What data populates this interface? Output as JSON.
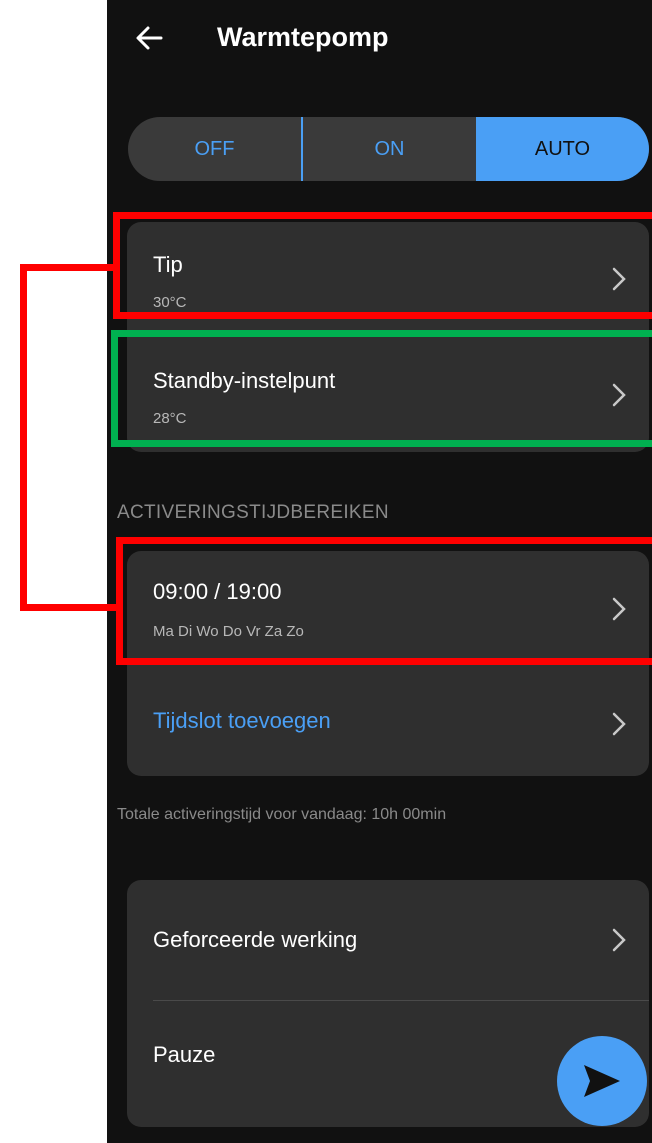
{
  "header": {
    "title": "Warmtepomp",
    "back_icon": "arrow-left-icon"
  },
  "mode_toggle": {
    "options": [
      "OFF",
      "ON",
      "AUTO"
    ],
    "selected": "AUTO"
  },
  "setpoints": [
    {
      "title": "Tip",
      "value": "30°C"
    },
    {
      "title": "Standby-instelpunt",
      "value": "28°C"
    }
  ],
  "activation": {
    "section_label": "ACTIVERINGSTIJDBEREIKEN",
    "slots": [
      {
        "time": "09:00 / 19:00",
        "days": "Ma Di Wo Do Vr Za Zo"
      }
    ],
    "add_label": "Tijdslot toevoegen",
    "total_text": "Totale activeringstijd voor vandaag: 10h 00min"
  },
  "extra": {
    "forced_label": "Geforceerde werking",
    "pause_label": "Pauze"
  },
  "fab": {
    "icon": "send-icon"
  },
  "colors": {
    "accent": "#4a9ff5",
    "background": "#111111",
    "card": "#2f2f2f",
    "annotation_red": "#ff0000",
    "annotation_green": "#00b050"
  }
}
